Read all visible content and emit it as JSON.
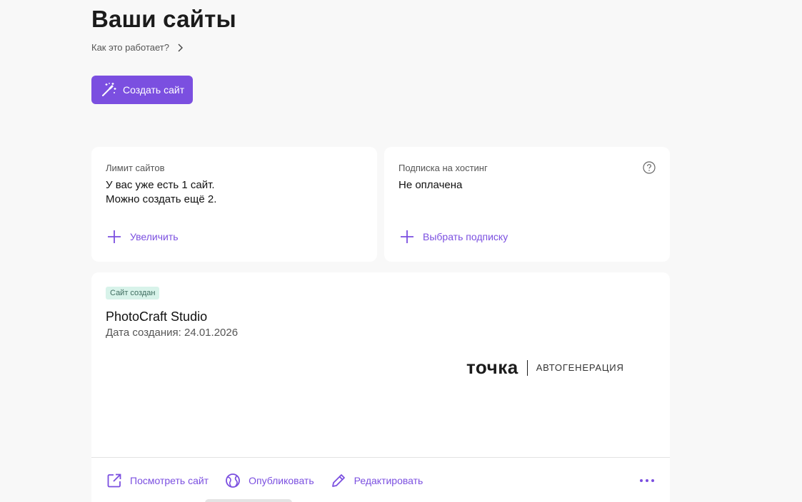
{
  "header": {
    "title": "Ваши сайты",
    "how_link": "Как это работает?"
  },
  "create_button": {
    "label": "Создать сайт"
  },
  "limit_card": {
    "label": "Лимит сайтов",
    "line1": "У вас уже есть 1 сайт.",
    "line2": "Можно создать ещё 2.",
    "action": "Увеличить"
  },
  "subscription_card": {
    "label": "Подписка на хостинг",
    "status": "Не оплачена",
    "action": "Выбрать подписку"
  },
  "site_card": {
    "badge": "Сайт создан",
    "name": "PhotoCraft Studio",
    "date": "Дата создания: 24.01.2026",
    "logo_main": "точка",
    "logo_sub": "АВТОГЕНЕРАЦИЯ",
    "actions": {
      "view": "Посмотреть сайт",
      "publish": "Опубликовать",
      "edit": "Редактировать"
    }
  },
  "colors": {
    "accent": "#7b4fe0",
    "badge_bg": "#d8f3ea"
  }
}
